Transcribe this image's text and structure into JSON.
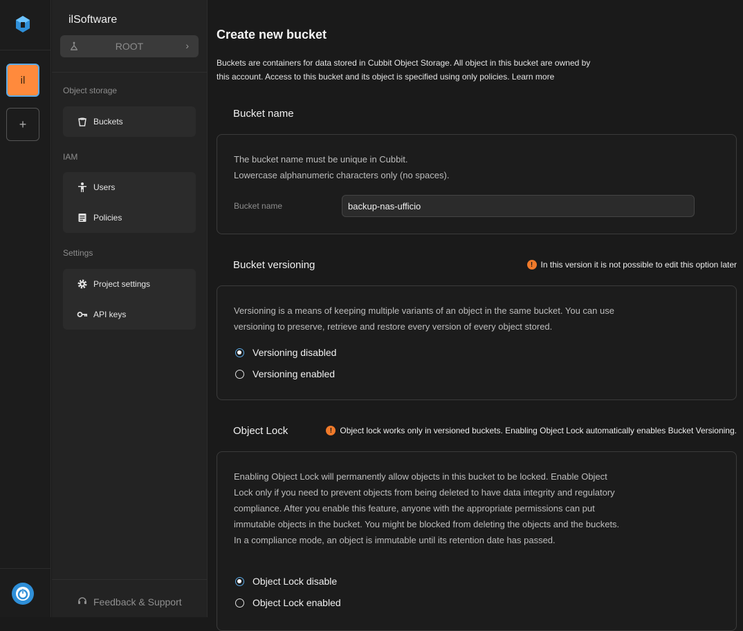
{
  "rail": {
    "project_initials": "il",
    "add_label": "+"
  },
  "sidebar": {
    "org_name": "ilSoftware",
    "root_label": "ROOT",
    "sections": {
      "object_storage": "Object storage",
      "iam": "IAM",
      "settings": "Settings"
    },
    "items": {
      "buckets": "Buckets",
      "users": "Users",
      "policies": "Policies",
      "project_settings": "Project settings",
      "api_keys": "API keys"
    },
    "feedback": "Feedback & Support"
  },
  "page": {
    "title": "Create new bucket",
    "description": "Buckets are containers for data stored in Cubbit Object Storage. All object in this bucket are owned by this account. Access to this bucket and its object is specified using only policies. Learn more"
  },
  "bucket_name": {
    "title": "Bucket name",
    "help_line1": "The bucket name must be unique in Cubbit.",
    "help_line2": "Lowercase alphanumeric characters only (no spaces).",
    "field_label": "Bucket name",
    "field_value": "backup-nas-ufficio"
  },
  "versioning": {
    "title": "Bucket versioning",
    "warning": "In this version it is not possible to edit this option later",
    "description": "Versioning is a means of keeping multiple variants of an object in the same bucket. You can use versioning to preserve, retrieve and restore every version of every object stored.",
    "options": [
      "Versioning disabled",
      "Versioning enabled"
    ],
    "selected_index": 0
  },
  "object_lock": {
    "title": "Object Lock",
    "warning": "Object lock works only in versioned buckets. Enabling Object Lock automatically enables Bucket Versioning.",
    "description": "Enabling Object Lock will permanently allow objects in this bucket to be locked. Enable Object Lock only if you need to prevent objects from being deleted to have data integrity and regulatory compliance. After you enable this feature, anyone with the appropriate permissions can put immutable objects in the bucket. You might be blocked from deleting the objects and the buckets. In a compliance mode, an object is immutable until its retention date has passed.",
    "options": [
      "Object Lock disable",
      "Object Lock enabled"
    ],
    "selected_index": 0
  },
  "colors": {
    "accent": "#2f8fd8",
    "project": "#ff8a3c",
    "warning": "#f07a2a"
  }
}
